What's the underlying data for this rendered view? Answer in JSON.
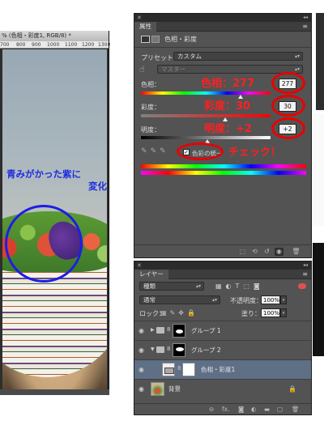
{
  "document": {
    "title": "% (色相・彩度1, RGB/8) *",
    "ruler": [
      "700",
      "800",
      "900",
      "1000",
      "1100",
      "1200",
      "1300"
    ],
    "annotation_line1": "青みがかった紫に",
    "annotation_line2": "変化"
  },
  "properties": {
    "tab": "属性",
    "header_title": "色相・彩度",
    "preset_label": "プリセット：",
    "preset_value": "カスタム",
    "channel_value": "マスター",
    "hue_label": "色相：",
    "hue_value": "277",
    "hue_fraction": 0.77,
    "saturation_label": "彩度：",
    "saturation_value": "30",
    "saturation_fraction": 0.65,
    "lightness_label": "明度：",
    "lightness_value": "+2",
    "lightness_fraction": 0.51,
    "colorize_label": "色彩の統一",
    "colorize_checked": true,
    "annot_hue": "色相：277",
    "annot_saturation": "彩度：30",
    "annot_lightness": "明度：+2",
    "annot_check": "チェック！"
  },
  "layers": {
    "tab": "レイヤー",
    "filter_value": "種類",
    "blend_mode": "通常",
    "opacity_label": "不透明度：",
    "opacity_value": "100%",
    "lock_label": "ロック：",
    "fill_label": "塗り：",
    "fill_value": "100%",
    "items": [
      {
        "name": "グループ 1"
      },
      {
        "name": "グループ 2"
      },
      {
        "name": "色相・彩度1"
      },
      {
        "name": "背景"
      }
    ]
  },
  "colors": {
    "annotation_red": "#ff2020",
    "annotation_blue": "#1f2ee0",
    "panel_bg": "#535353",
    "selected_layer": "#5e6f86"
  }
}
